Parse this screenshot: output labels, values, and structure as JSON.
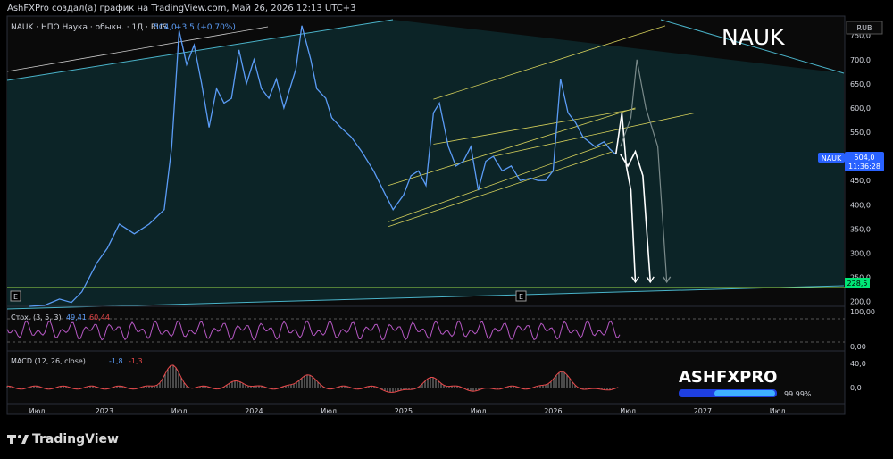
{
  "header": {
    "caption": "AshFXPro создал(а) график на TradingView.com, Май 26, 2026 12:13 UTC+3",
    "legend": "NAUK · НПО Наука · обыкн. · 1Д · RUS",
    "price": "504,0",
    "change": "+3,5 (+0,70%)",
    "ticker_title": "NAUK",
    "currency": "RUB"
  },
  "price_label": {
    "ticker": "NAUK",
    "value": "504,0",
    "countdown": "11:36:28"
  },
  "support_label": "228,5",
  "event_marker": "E",
  "stoch": {
    "label": "Стох. (3, 5, 3)",
    "k": "49,41",
    "d": "60,44",
    "ticks": [
      "100,00",
      "0,00"
    ]
  },
  "macd": {
    "label": "MACD (12, 26, close)",
    "v1": "-1,8",
    "v2": "-1,3",
    "ticks": [
      "40,0",
      "0,0"
    ]
  },
  "watermark": {
    "brand": "ASHFXPRO",
    "percent": "99.99%"
  },
  "footer": {
    "logo": "TradingView"
  },
  "colors": {
    "bg": "#000000",
    "channel": "#0c2427",
    "price_line": "#5b9cf6",
    "trend": "#d4cf5a",
    "support": "#9bdc49",
    "stoch": "#b658c4",
    "macd": "#e8484a"
  },
  "chart_data": {
    "type": "line",
    "title": "NAUK",
    "ylim": [
      190,
      790
    ],
    "y_ticks": [
      750,
      700,
      650,
      600,
      550,
      500,
      450,
      400,
      350,
      300,
      250,
      200
    ],
    "y_tick_labels": [
      "750,0",
      "700,0",
      "650,0",
      "600,0",
      "550,0",
      "500,0",
      "450,0",
      "400,0",
      "350,0",
      "300,0",
      "250,0",
      "200,0"
    ],
    "x_tick_labels": [
      "Июл",
      "2023",
      "Июл",
      "2024",
      "Июл",
      "2025",
      "Июл",
      "2026",
      "Июл",
      "2027",
      "Июл"
    ],
    "series": [
      {
        "values": [
          [
            2022.5,
            185
          ],
          [
            2022.6,
            192
          ],
          [
            2022.7,
            205
          ],
          [
            2022.78,
            198
          ],
          [
            2022.85,
            220
          ],
          [
            2022.95,
            280
          ],
          [
            2023.02,
            310
          ],
          [
            2023.1,
            360
          ],
          [
            2023.2,
            340
          ],
          [
            2023.3,
            360
          ],
          [
            2023.4,
            390
          ],
          [
            2023.45,
            520
          ],
          [
            2023.5,
            760
          ],
          [
            2023.55,
            690
          ],
          [
            2023.6,
            730
          ],
          [
            2023.65,
            650
          ],
          [
            2023.7,
            560
          ],
          [
            2023.75,
            640
          ],
          [
            2023.8,
            610
          ],
          [
            2023.85,
            620
          ],
          [
            2023.9,
            720
          ],
          [
            2023.95,
            650
          ],
          [
            2024.0,
            700
          ],
          [
            2024.05,
            640
          ],
          [
            2024.1,
            620
          ],
          [
            2024.15,
            660
          ],
          [
            2024.2,
            600
          ],
          [
            2024.28,
            680
          ],
          [
            2024.32,
            770
          ],
          [
            2024.38,
            700
          ],
          [
            2024.42,
            640
          ],
          [
            2024.48,
            620
          ],
          [
            2024.52,
            580
          ],
          [
            2024.58,
            560
          ],
          [
            2024.65,
            540
          ],
          [
            2024.72,
            510
          ],
          [
            2024.8,
            470
          ],
          [
            2024.88,
            420
          ],
          [
            2024.93,
            390
          ],
          [
            2025.0,
            420
          ],
          [
            2025.05,
            460
          ],
          [
            2025.1,
            470
          ],
          [
            2025.15,
            440
          ],
          [
            2025.2,
            590
          ],
          [
            2025.24,
            610
          ],
          [
            2025.3,
            520
          ],
          [
            2025.35,
            480
          ],
          [
            2025.4,
            490
          ],
          [
            2025.45,
            520
          ],
          [
            2025.5,
            430
          ],
          [
            2025.55,
            490
          ],
          [
            2025.6,
            500
          ],
          [
            2025.66,
            470
          ],
          [
            2025.72,
            480
          ],
          [
            2025.78,
            450
          ],
          [
            2025.85,
            455
          ],
          [
            2025.9,
            450
          ],
          [
            2025.95,
            450
          ],
          [
            2026.0,
            470
          ],
          [
            2026.05,
            660
          ],
          [
            2026.1,
            590
          ],
          [
            2026.15,
            570
          ],
          [
            2026.2,
            540
          ],
          [
            2026.28,
            520
          ],
          [
            2026.34,
            530
          ],
          [
            2026.38,
            515
          ],
          [
            2026.42,
            504
          ]
        ]
      },
      {
        "values": [
          [
            2026.42,
            504
          ],
          [
            2026.46,
            590
          ],
          [
            2026.49,
            480
          ],
          [
            2026.52,
            430
          ],
          [
            2026.55,
            240
          ]
        ]
      },
      {
        "values": [
          [
            2026.45,
            504
          ],
          [
            2026.5,
            480
          ],
          [
            2026.55,
            510
          ],
          [
            2026.6,
            460
          ],
          [
            2026.65,
            240
          ]
        ]
      },
      {
        "values": [
          [
            2026.45,
            520
          ],
          [
            2026.52,
            580
          ],
          [
            2026.56,
            700
          ],
          [
            2026.62,
            600
          ],
          [
            2026.7,
            520
          ],
          [
            2026.76,
            240
          ]
        ]
      }
    ],
    "trendlines": [
      {
        "from": [
          2024.9,
          365
        ],
        "to": [
          2026.4,
          530
        ]
      },
      {
        "from": [
          2024.9,
          355
        ],
        "to": [
          2026.4,
          510
        ]
      },
      {
        "from": [
          2024.9,
          440
        ],
        "to": [
          2026.55,
          600
        ]
      },
      {
        "from": [
          2025.2,
          525
        ],
        "to": [
          2026.55,
          598
        ]
      },
      {
        "from": [
          2025.2,
          618
        ],
        "to": [
          2026.75,
          770
        ]
      },
      {
        "from": [
          2025.6,
          500
        ],
        "to": [
          2026.95,
          590
        ]
      }
    ],
    "support": 228.5
  }
}
